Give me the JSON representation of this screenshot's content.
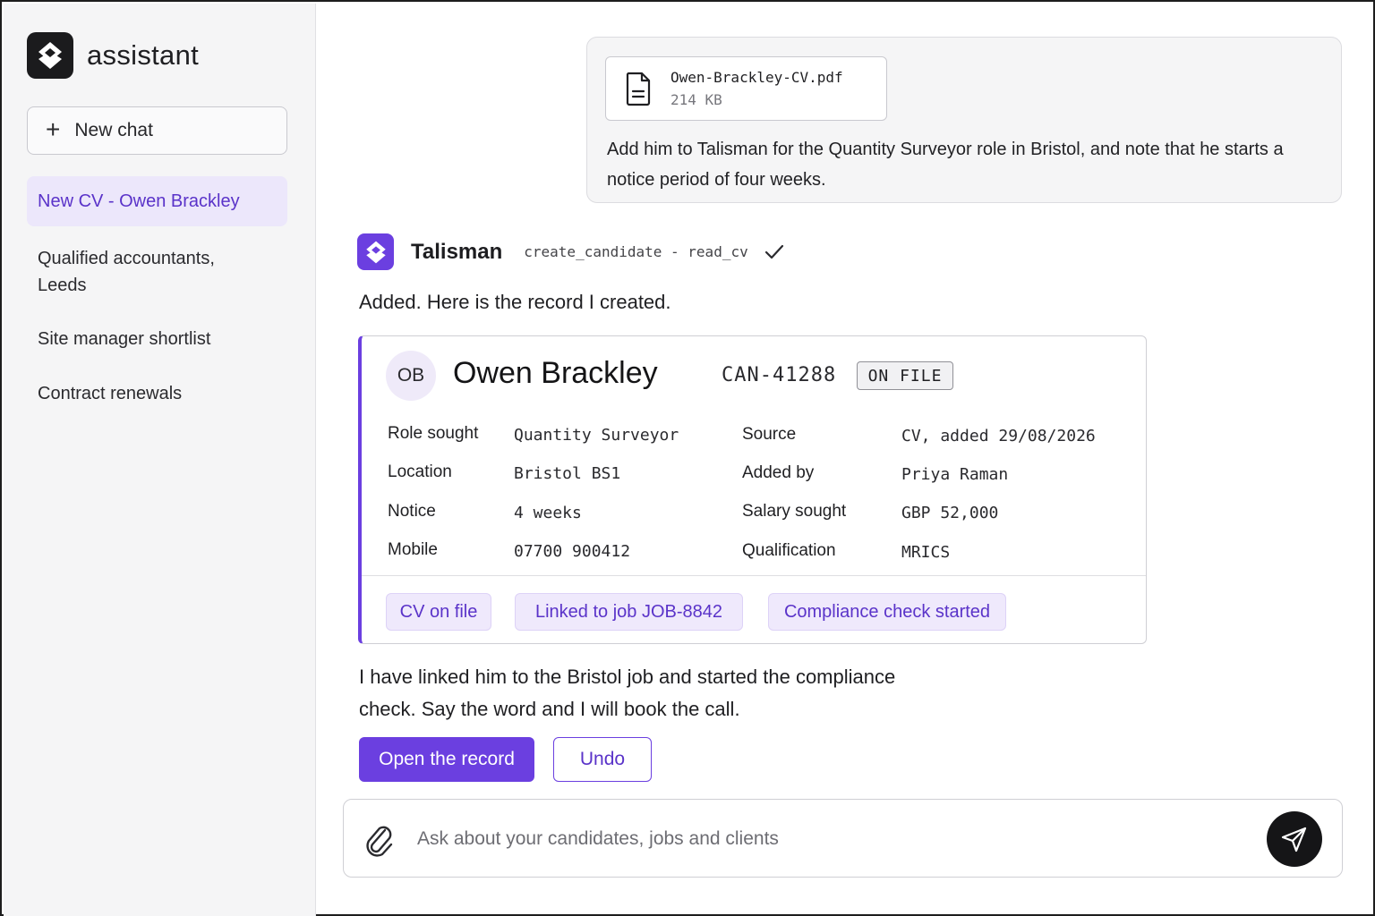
{
  "sidebar": {
    "brand": "assistant",
    "new_chat": "New chat",
    "conversations": [
      "New CV - Owen Brackley",
      "Qualified accountants, Leeds",
      "Site manager shortlist",
      "Contract renewals"
    ]
  },
  "user_message": {
    "file_name": "Owen-Brackley-CV.pdf",
    "file_size": "214 KB",
    "text": "Add him to Talisman for the Quantity Surveyor role in Bristol, and note that he starts a notice period of four weeks."
  },
  "agent": {
    "name": "Talisman",
    "tools": "create_candidate - read_cv",
    "reply_intro": "Added. Here is the record I created.",
    "reply_followup": "I have linked him to the Bristol job and started the compliance check. Say the word and I will book the call."
  },
  "record": {
    "initials": "OB",
    "name": "Owen Brackley",
    "id": "CAN-41288",
    "status": "ON FILE",
    "left_fields": [
      {
        "label": "Role sought",
        "value": "Quantity Surveyor"
      },
      {
        "label": "Location",
        "value": "Bristol BS1"
      },
      {
        "label": "Notice",
        "value": "4 weeks"
      },
      {
        "label": "Mobile",
        "value": "07700 900412"
      }
    ],
    "right_fields": [
      {
        "label": "Source",
        "value": "CV, added 29/08/2026"
      },
      {
        "label": "Added by",
        "value": "Priya Raman"
      },
      {
        "label": "Salary sought",
        "value": "GBP 52,000"
      },
      {
        "label": "Qualification",
        "value": "MRICS"
      }
    ],
    "tags": [
      "CV on file",
      "Linked to job JOB-8842",
      "Compliance check started"
    ]
  },
  "actions": {
    "primary": "Open the record",
    "secondary": "Undo"
  },
  "composer": {
    "placeholder": "Ask about your candidates, jobs and clients"
  },
  "colors": {
    "accent": "#6b3fe0",
    "accent_soft": "#efe9fc",
    "sidebar_bg": "#f5f5f6"
  }
}
